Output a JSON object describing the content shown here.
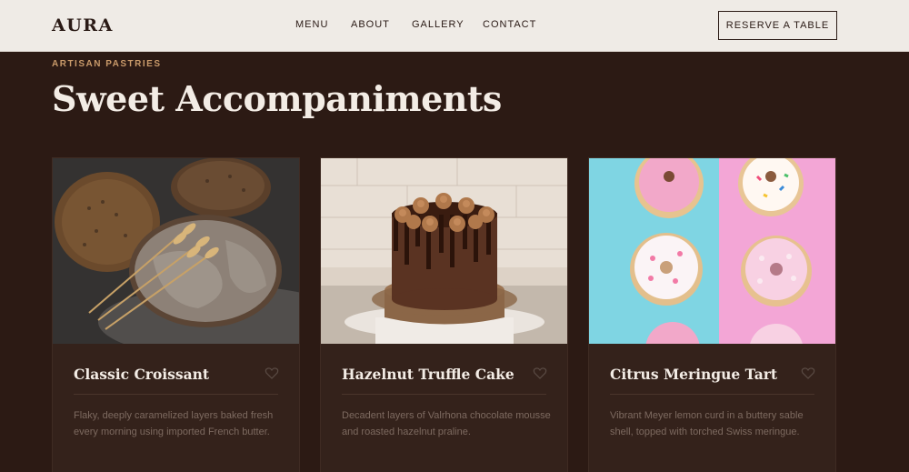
{
  "header": {
    "logo": "AURA",
    "nav": [
      "MENU",
      "ABOUT",
      "GALLERY",
      "CONTACT"
    ],
    "cta": "RESERVE A TABLE"
  },
  "hero": {
    "eyebrow": "ARTISAN PASTRIES",
    "title": "Sweet Accompaniments"
  },
  "cards": [
    {
      "title": "Classic Croissant",
      "description": "Flaky, deeply caramelized layers baked fresh every morning using imported French butter.",
      "image": "rustic-bread-with-wheat"
    },
    {
      "title": "Hazelnut Truffle Cake",
      "description": "Decadent layers of Valrhona chocolate mousse and roasted hazelnut praline.",
      "image": "chocolate-drip-cake"
    },
    {
      "title": "Citrus Meringue Tart",
      "description": "Vibrant Meyer lemon curd in a buttery sable shell, topped with torched Swiss meringue.",
      "image": "donuts-on-blue-pink"
    }
  ],
  "colors": {
    "background": "#2c1a14",
    "nav": "#efebe6",
    "accent": "#c99a6a",
    "card": "#34221b"
  }
}
